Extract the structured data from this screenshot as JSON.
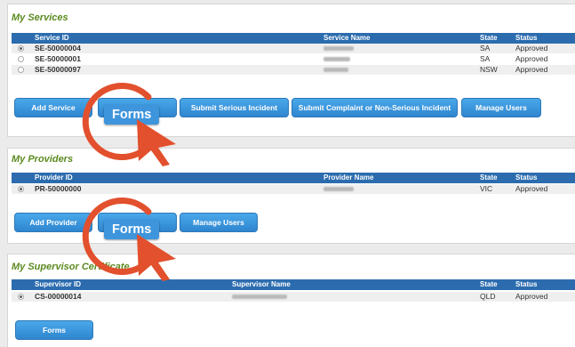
{
  "services": {
    "title": "My Services",
    "columns": [
      "Service ID",
      "Service Name",
      "State",
      "Status"
    ],
    "rows": [
      {
        "id": "SE-50000004",
        "state": "SA",
        "status": "Approved"
      },
      {
        "id": "SE-50000001",
        "state": "SA",
        "status": "Approved"
      },
      {
        "id": "SE-50000097",
        "state": "NSW",
        "status": "Approved"
      }
    ],
    "buttons": {
      "add": "Add Service",
      "forms": "Forms",
      "serious": "Submit Serious Incident",
      "complaint": "Submit Complaint or Non-Serious Incident",
      "users": "Manage Users"
    }
  },
  "providers": {
    "title": "My Providers",
    "columns": [
      "Provider ID",
      "Provider Name",
      "State",
      "Status"
    ],
    "rows": [
      {
        "id": "PR-50000000",
        "state": "VIC",
        "status": "Approved"
      }
    ],
    "buttons": {
      "add": "Add Provider",
      "forms": "Forms",
      "users": "Manage Users"
    }
  },
  "supervisor": {
    "title": "My Supervisor Certificate",
    "columns": [
      "Supervisor ID",
      "Supervisor Name",
      "State",
      "Status"
    ],
    "rows": [
      {
        "id": "CS-00000014",
        "state": "QLD",
        "status": "Approved"
      }
    ],
    "buttons": {
      "forms": "Forms"
    }
  },
  "annotation_colors": {
    "ring": "#e2502d",
    "panel_title": "#5b8a1f",
    "table_header": "#2c6cae"
  }
}
